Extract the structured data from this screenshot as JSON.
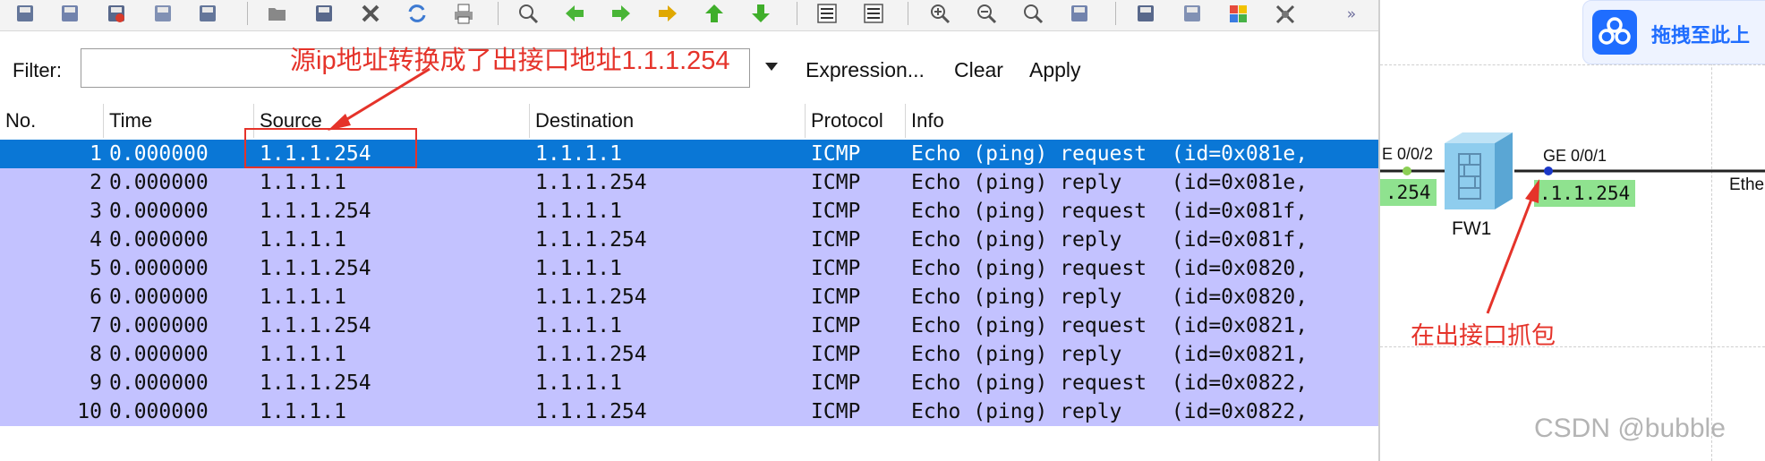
{
  "toolbar": {
    "icons": [
      "open-file-icon",
      "save-file-icon",
      "close-file-icon",
      "reload-file-icon",
      "save-as-icon",
      "open-icon",
      "save-icon",
      "close-icon",
      "reload-icon",
      "print-icon",
      "find-packet-icon",
      "go-back-icon",
      "go-forward-icon",
      "go-to-packet-icon",
      "go-first-icon",
      "go-last-icon",
      "colorize-icon",
      "auto-scroll-icon",
      "zoom-in-icon",
      "zoom-out-icon",
      "normal-size-icon",
      "resize-columns-icon",
      "capture-filters-icon",
      "display-filters-icon",
      "coloring-rules-icon",
      "preferences-icon"
    ],
    "more_label": "»"
  },
  "filter": {
    "label": "Filter:",
    "value": "",
    "expression_label": "Expression...",
    "clear_label": "Clear",
    "apply_label": "Apply"
  },
  "columns": [
    "No.",
    "Time",
    "Source",
    "Destination",
    "Protocol",
    "Info"
  ],
  "packets": [
    {
      "no": "1",
      "time": "0.000000",
      "source": "1.1.1.254",
      "destination": "1.1.1.1",
      "protocol": "ICMP",
      "info": "Echo (ping) request  (id=0x081e,"
    },
    {
      "no": "2",
      "time": "0.000000",
      "source": "1.1.1.1",
      "destination": "1.1.1.254",
      "protocol": "ICMP",
      "info": "Echo (ping) reply    (id=0x081e,"
    },
    {
      "no": "3",
      "time": "0.000000",
      "source": "1.1.1.254",
      "destination": "1.1.1.1",
      "protocol": "ICMP",
      "info": "Echo (ping) request  (id=0x081f,"
    },
    {
      "no": "4",
      "time": "0.000000",
      "source": "1.1.1.1",
      "destination": "1.1.1.254",
      "protocol": "ICMP",
      "info": "Echo (ping) reply    (id=0x081f,"
    },
    {
      "no": "5",
      "time": "0.000000",
      "source": "1.1.1.254",
      "destination": "1.1.1.1",
      "protocol": "ICMP",
      "info": "Echo (ping) request  (id=0x0820,"
    },
    {
      "no": "6",
      "time": "0.000000",
      "source": "1.1.1.1",
      "destination": "1.1.1.254",
      "protocol": "ICMP",
      "info": "Echo (ping) reply    (id=0x0820,"
    },
    {
      "no": "7",
      "time": "0.000000",
      "source": "1.1.1.254",
      "destination": "1.1.1.1",
      "protocol": "ICMP",
      "info": "Echo (ping) request  (id=0x0821,"
    },
    {
      "no": "8",
      "time": "0.000000",
      "source": "1.1.1.1",
      "destination": "1.1.1.254",
      "protocol": "ICMP",
      "info": "Echo (ping) reply    (id=0x0821,"
    },
    {
      "no": "9",
      "time": "0.000000",
      "source": "1.1.1.254",
      "destination": "1.1.1.1",
      "protocol": "ICMP",
      "info": "Echo (ping) request  (id=0x0822,"
    },
    {
      "no": "10",
      "time": "0.000000",
      "source": "1.1.1.1",
      "destination": "1.1.1.254",
      "protocol": "ICMP",
      "info": "Echo (ping) reply    (id=0x0822,"
    }
  ],
  "selected_row": 1,
  "colors": {
    "row_icmp": "#c3c2ff",
    "row_selected": "#0a77d6",
    "annotation_red": "#e5332a",
    "ip_chip_green": "#8fe28f",
    "upload_blue": "#1f6dff"
  },
  "topology": {
    "upload_label": "拖拽至此上",
    "left_port_label": "E 0/0/2",
    "right_port_label": "GE 0/0/1",
    "left_ip": ".254",
    "right_ip": ".1.1.254",
    "device_label": "FW1",
    "eth_label": "Ethe",
    "watermark": "CSDN @bubble"
  },
  "annotations": {
    "source_note": "源ip地址转换成了出接口地址1.1.1.254",
    "capture_note": "在出接口抓包"
  }
}
